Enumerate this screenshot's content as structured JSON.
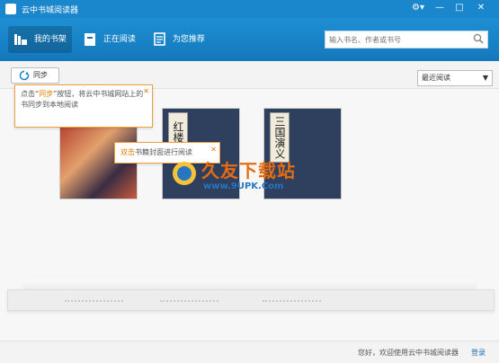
{
  "app": {
    "title": "云中书城阅读器"
  },
  "window_controls": {
    "menu": "⚙▾",
    "minimize": "—",
    "maximize": "□",
    "close": "✕"
  },
  "nav": {
    "items": [
      {
        "label": "我的书架",
        "icon": "bookshelf-icon"
      },
      {
        "label": "正在阅读",
        "icon": "book-icon"
      },
      {
        "label": "为您推荐",
        "icon": "recommend-icon"
      }
    ]
  },
  "search": {
    "placeholder": "输入书名、作者或书号"
  },
  "toolbar": {
    "sync_label": "同步",
    "sort_value": "最近阅读"
  },
  "tips": {
    "sync_tip_pre": "点击“",
    "sync_tip_hl": "同步",
    "sync_tip_post": "”按钮，将云中书城网站上的书同步到本地阅读",
    "read_tip_hl": "双击",
    "read_tip_post": "书籍封面进行阅读"
  },
  "books": [
    {
      "title": ""
    },
    {
      "title": "红楼梦"
    },
    {
      "title": "三国演义"
    }
  ],
  "watermark": {
    "name": "久友下载站",
    "url": "www.9UPK.Com"
  },
  "status": {
    "message": "您好，欢迎使用云中书城阅读器",
    "login": "登录"
  },
  "colors": {
    "primary": "#1a86cc",
    "accent": "#e87a00"
  }
}
